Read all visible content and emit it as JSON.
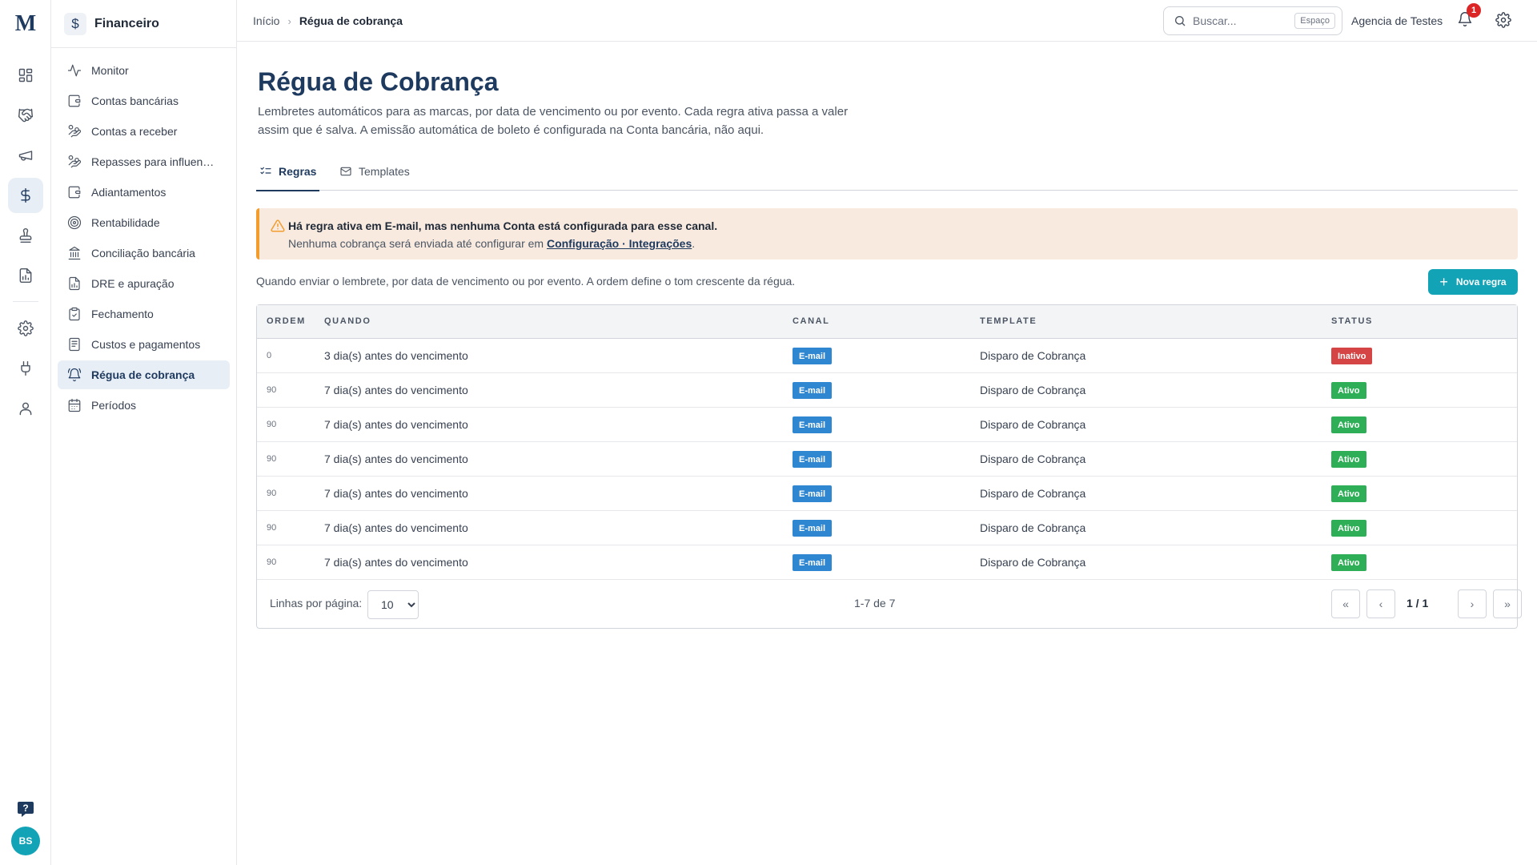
{
  "brand": {
    "logo_letter": "M",
    "accent": "#13a3b6",
    "primary": "#1e3a5f"
  },
  "rail": {
    "items": [
      "dashboard-icon",
      "handshake-icon",
      "megaphone-icon",
      "dollar-icon",
      "stamp-icon",
      "report-icon",
      "settings-icon",
      "plug-icon",
      "user-icon"
    ],
    "active": "dollar-icon",
    "avatar_initials": "BS"
  },
  "sidebar": {
    "title": "Financeiro",
    "items": [
      {
        "label": "Monitor",
        "icon": "activity-icon"
      },
      {
        "label": "Contas bancárias",
        "icon": "wallet-icon"
      },
      {
        "label": "Contas a receber",
        "icon": "hand-coins-icon"
      },
      {
        "label": "Repasses para influen…",
        "icon": "hand-coins-icon"
      },
      {
        "label": "Adiantamentos",
        "icon": "wallet-icon"
      },
      {
        "label": "Rentabilidade",
        "icon": "target-icon"
      },
      {
        "label": "Conciliação bancária",
        "icon": "bank-icon"
      },
      {
        "label": "DRE e apuração",
        "icon": "report-icon"
      },
      {
        "label": "Fechamento",
        "icon": "clipboard-check-icon"
      },
      {
        "label": "Custos e pagamentos",
        "icon": "receipt-icon"
      },
      {
        "label": "Régua de cobrança",
        "icon": "bell-ring-icon",
        "active": true
      },
      {
        "label": "Períodos",
        "icon": "calendar-icon"
      }
    ]
  },
  "topbar": {
    "breadcrumb": {
      "home": "Início",
      "current": "Régua de cobrança"
    },
    "search": {
      "placeholder": "Buscar...",
      "shortcut": "Espaço"
    },
    "agency": "Agencia de Testes",
    "notifications_count": "1"
  },
  "page": {
    "title": "Régua de Cobrança",
    "description": "Lembretes automáticos para as marcas, por data de vencimento ou por evento. Cada regra ativa passa a valer assim que é salva. A emissão automática de boleto é configurada na Conta bancária, não aqui.",
    "tabs": [
      {
        "label": "Regras",
        "active": true
      },
      {
        "label": "Templates",
        "active": false
      }
    ],
    "alert": {
      "title": "Há regra ativa em E-mail, mas nenhuma Conta está configurada para esse canal.",
      "text_before": "Nenhuma cobrança será enviada até configurar em ",
      "link": "Configuração · Integrações",
      "text_after": "."
    },
    "hint": "Quando enviar o lembrete, por data de vencimento ou por evento. A ordem define o tom crescente da régua.",
    "new_rule_label": "Nova regra"
  },
  "table": {
    "columns": [
      "ORDEM",
      "QUANDO",
      "CANAL",
      "TEMPLATE",
      "STATUS"
    ],
    "rows": [
      {
        "ordem": "0",
        "quando": "3 dia(s) antes do vencimento",
        "canal": "E-mail",
        "template": "Disparo de Cobrança",
        "status": "Inativo",
        "status_color": "#d64545"
      },
      {
        "ordem": "90",
        "quando": "7 dia(s) antes do vencimento",
        "canal": "E-mail",
        "template": "Disparo de Cobrança",
        "status": "Ativo",
        "status_color": "#2eaf57"
      },
      {
        "ordem": "90",
        "quando": "7 dia(s) antes do vencimento",
        "canal": "E-mail",
        "template": "Disparo de Cobrança",
        "status": "Ativo",
        "status_color": "#2eaf57"
      },
      {
        "ordem": "90",
        "quando": "7 dia(s) antes do vencimento",
        "canal": "E-mail",
        "template": "Disparo de Cobrança",
        "status": "Ativo",
        "status_color": "#2eaf57"
      },
      {
        "ordem": "90",
        "quando": "7 dia(s) antes do vencimento",
        "canal": "E-mail",
        "template": "Disparo de Cobrança",
        "status": "Ativo",
        "status_color": "#2eaf57"
      },
      {
        "ordem": "90",
        "quando": "7 dia(s) antes do vencimento",
        "canal": "E-mail",
        "template": "Disparo de Cobrança",
        "status": "Ativo",
        "status_color": "#2eaf57"
      },
      {
        "ordem": "90",
        "quando": "7 dia(s) antes do vencimento",
        "canal": "E-mail",
        "template": "Disparo de Cobrança",
        "status": "Ativo",
        "status_color": "#2eaf57"
      }
    ],
    "footer": {
      "rows_per_page_label": "Linhas por página:",
      "rows_per_page_value": "10",
      "range": "1-7 de 7",
      "page_info": "1 / 1"
    }
  }
}
